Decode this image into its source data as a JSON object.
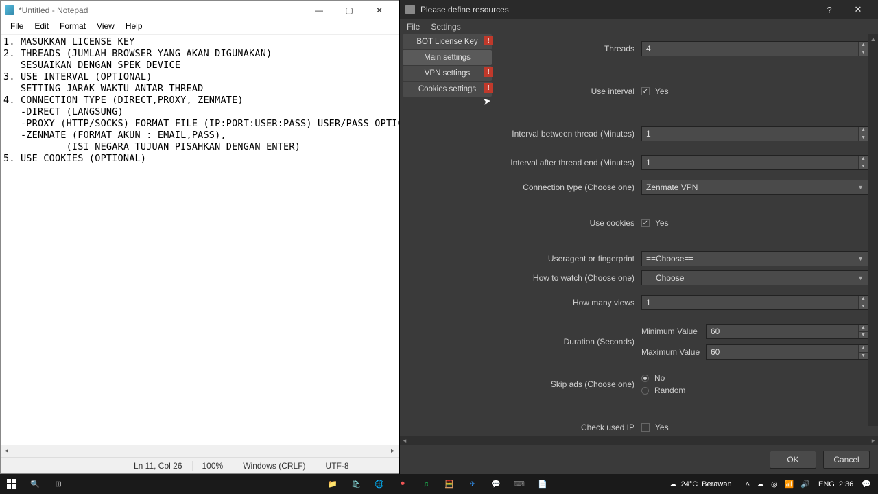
{
  "notepad": {
    "title": "*Untitled - Notepad",
    "menu": [
      "File",
      "Edit",
      "Format",
      "View",
      "Help"
    ],
    "content": "1. MASUKKAN LICENSE KEY\n2. THREADS (JUMLAH BROWSER YANG AKAN DIGUNAKAN)\n   SESUAIKAN DENGAN SPEK DEVICE\n3. USE INTERVAL (OPTIONAL)\n   SETTING JARAK WAKTU ANTAR THREAD\n4. CONNECTION TYPE (DIRECT,PROXY, ZENMATE)\n   -DIRECT (LANGSUNG)\n   -PROXY (HTTP/SOCKS) FORMAT FILE (IP:PORT:USER:PASS) USER/PASS OPTIONAL\n   -ZENMATE (FORMAT AKUN : EMAIL,PASS),\n           (ISI NEGARA TUJUAN PISAHKAN DENGAN ENTER)\n5. USE COOKIES (OPTIONAL)",
    "status": {
      "pos": "Ln 11, Col 26",
      "zoom": "100%",
      "eol": "Windows (CRLF)",
      "enc": "UTF-8"
    }
  },
  "dialog": {
    "title": "Please define resources",
    "menu": [
      "File",
      "Settings"
    ],
    "sidebar": [
      {
        "label": "BOT License Key",
        "warn": true
      },
      {
        "label": "Main settings",
        "warn": false,
        "selected": true
      },
      {
        "label": "VPN settings",
        "warn": true
      },
      {
        "label": "Cookies settings",
        "warn": true
      }
    ],
    "fields": {
      "threads": {
        "label": "Threads",
        "value": "4"
      },
      "use_interval": {
        "label": "Use interval",
        "checked": true,
        "text": "Yes"
      },
      "interval_between": {
        "label": "Interval between thread (Minutes)",
        "value": "1"
      },
      "interval_after": {
        "label": "Interval after thread end (Minutes)",
        "value": "1"
      },
      "connection_type": {
        "label": "Connection type (Choose one)",
        "value": "Zenmate VPN"
      },
      "use_cookies": {
        "label": "Use cookies",
        "checked": true,
        "text": "Yes"
      },
      "useragent": {
        "label": "Useragent or fingerprint",
        "value": "==Choose=="
      },
      "how_watch": {
        "label": "How to watch (Choose one)",
        "value": "==Choose=="
      },
      "views": {
        "label": "How many views",
        "value": "1"
      },
      "duration": {
        "label": "Duration (Seconds)",
        "min_label": "Minimum Value",
        "min": "60",
        "max_label": "Maximum Value",
        "max": "60"
      },
      "skip_ads": {
        "label": "Skip ads (Choose one)",
        "opts": [
          "No",
          "Random"
        ],
        "selected": 0
      },
      "check_ip": {
        "label": "Check used IP",
        "checked": false,
        "text": "Yes"
      }
    },
    "buttons": {
      "ok": "OK",
      "cancel": "Cancel"
    }
  },
  "taskbar": {
    "weather": {
      "temp": "24°C",
      "cond": "Berawan"
    },
    "lang": "ENG",
    "time": "2:36"
  }
}
